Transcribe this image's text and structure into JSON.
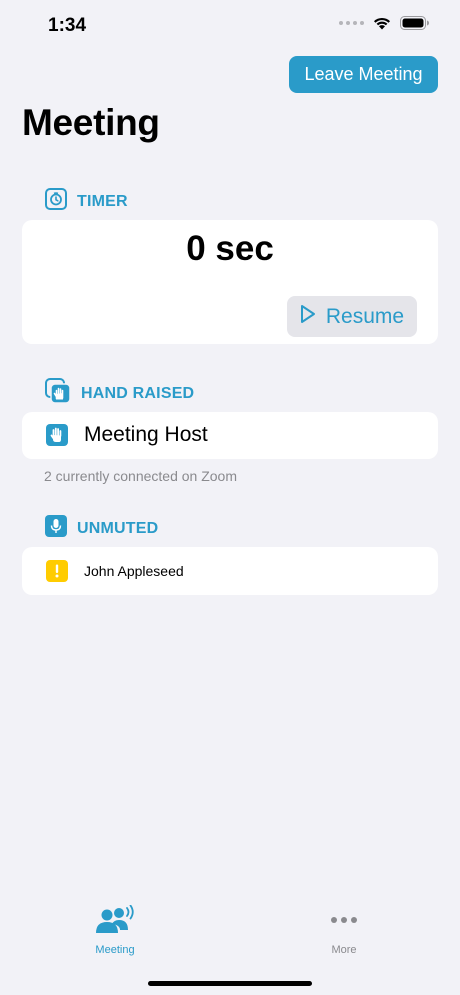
{
  "status_bar": {
    "time": "1:34"
  },
  "header": {
    "leave_label": "Leave Meeting",
    "title": "Meeting"
  },
  "timer": {
    "section_label": "TIMER",
    "value": "0 sec",
    "resume_label": "Resume"
  },
  "hand_raised": {
    "section_label": "HAND RAISED",
    "name": "Meeting Host",
    "footnote": "2 currently connected on Zoom"
  },
  "unmuted": {
    "section_label": "UNMUTED",
    "name": "John Appleseed"
  },
  "tab_bar": {
    "tabs": [
      {
        "label": "Meeting",
        "selected": true
      },
      {
        "label": "More",
        "selected": false
      }
    ]
  },
  "colors": {
    "accent": "#2a9bc9",
    "warning": "#ffcc00",
    "background": "#f2f2f7",
    "secondary_text": "#8a8a8e"
  }
}
